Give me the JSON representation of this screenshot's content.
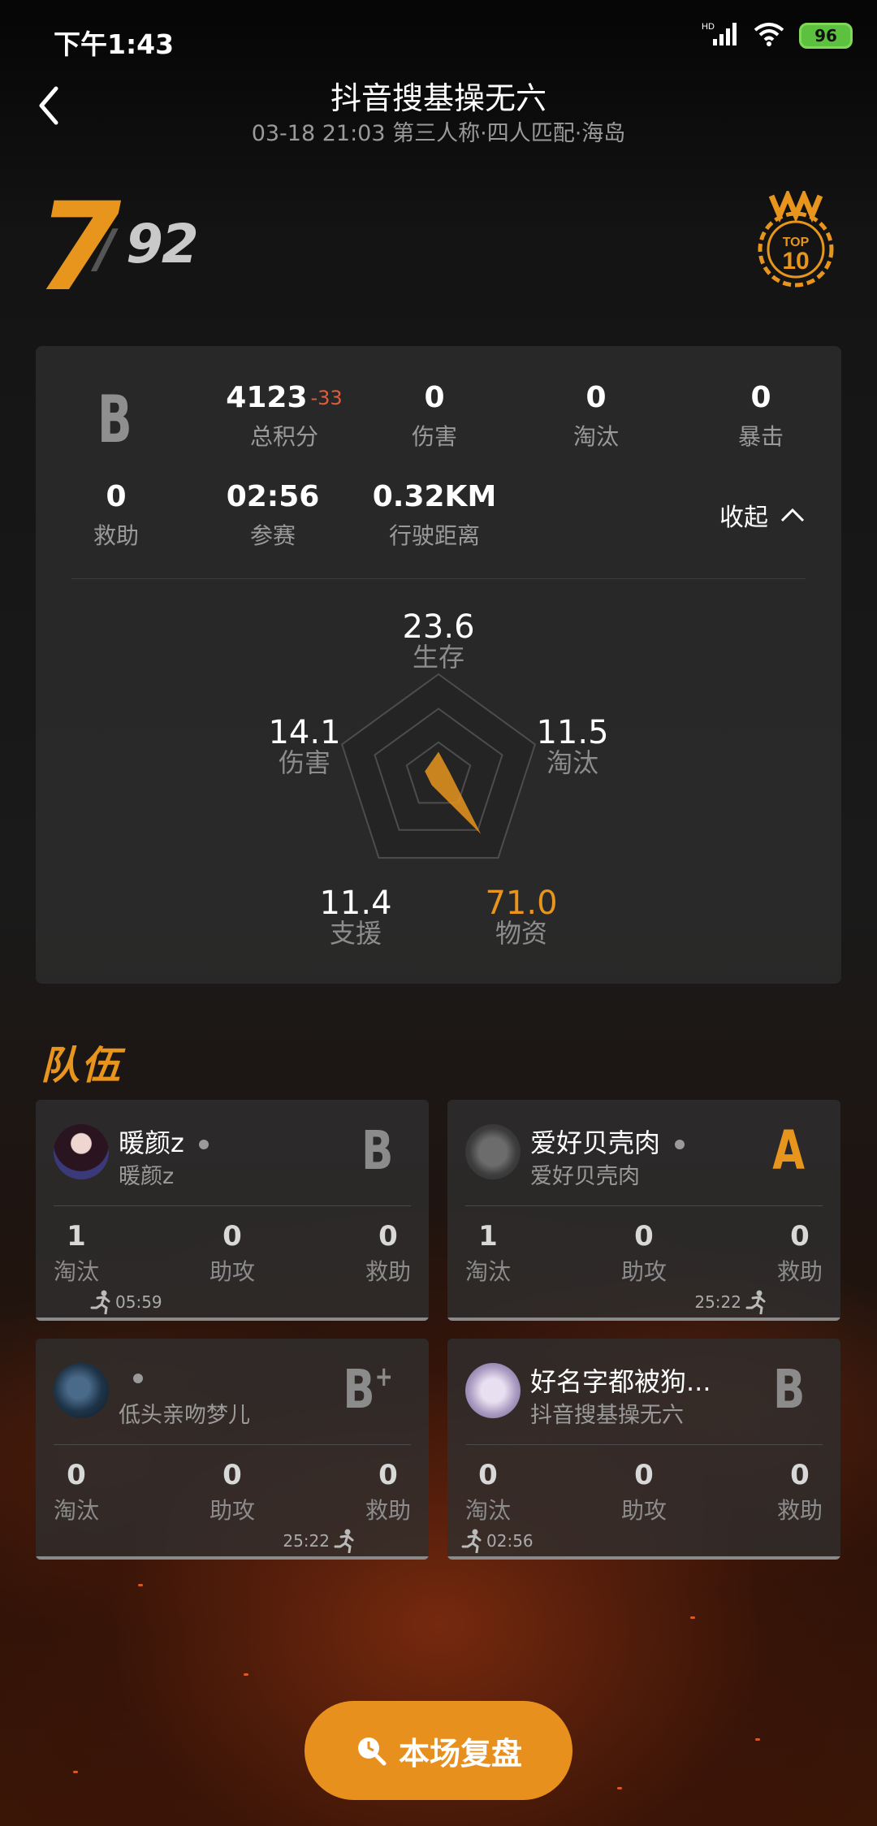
{
  "status_bar": {
    "time": "下午1:43",
    "network": "HD",
    "battery": "96"
  },
  "header": {
    "title": "抖音搜基操无六",
    "subtitle": "03-18 21:03 第三人称·四人匹配·海岛"
  },
  "rank": {
    "place": "7",
    "separator": "/",
    "total": "92",
    "badge_text_top": "TOP",
    "badge_text_num": "10"
  },
  "stats": {
    "grade": "B",
    "total_score": {
      "value": "4123",
      "delta": "-33",
      "label": "总积分"
    },
    "damage": {
      "value": "0",
      "label": "伤害"
    },
    "kills": {
      "value": "0",
      "label": "淘汰"
    },
    "crits": {
      "value": "0",
      "label": "暴击"
    },
    "assists": {
      "value": "0",
      "label": "救助"
    },
    "time_played": {
      "value": "02:56",
      "label": "参赛"
    },
    "drive_distance": {
      "value": "0.32KM",
      "label": "行驶距离"
    },
    "collapse_label": "收起"
  },
  "radar": {
    "survival": {
      "value": "23.6",
      "label": "生存"
    },
    "damage": {
      "value": "14.1",
      "label": "伤害"
    },
    "kills": {
      "value": "11.5",
      "label": "淘汰"
    },
    "support": {
      "value": "11.4",
      "label": "支援"
    },
    "supplies": {
      "value": "71.0",
      "label": "物资"
    },
    "accent_color": "#e8951e",
    "scale_max": 100
  },
  "team": {
    "title": "队伍",
    "members": [
      {
        "name": "暖颜z",
        "sub": "暖颜z",
        "grade": "B",
        "kills": "1",
        "kills_label": "淘汰",
        "assists": "0",
        "assists_label": "助攻",
        "rescues": "0",
        "rescues_label": "救助",
        "time": "05:59"
      },
      {
        "name": "爱好贝壳肉",
        "sub": "爱好贝壳肉",
        "grade": "A",
        "kills": "1",
        "kills_label": "淘汰",
        "assists": "0",
        "assists_label": "助攻",
        "rescues": "0",
        "rescues_label": "救助",
        "time": "25:22"
      },
      {
        "name": "",
        "sub": "低头亲吻梦儿",
        "grade": "B",
        "grade_plus": "+",
        "kills": "0",
        "kills_label": "淘汰",
        "assists": "0",
        "assists_label": "助攻",
        "rescues": "0",
        "rescues_label": "救助",
        "time": "25:22"
      },
      {
        "name": "好名字都被狗...",
        "sub": "抖音搜基操无六",
        "grade": "B",
        "kills": "0",
        "kills_label": "淘汰",
        "assists": "0",
        "assists_label": "助攻",
        "rescues": "0",
        "rescues_label": "救助",
        "time": "02:56"
      }
    ]
  },
  "replay_button": {
    "label": "本场复盘",
    "icon": "search-clock-icon",
    "color": "#e8901d"
  }
}
